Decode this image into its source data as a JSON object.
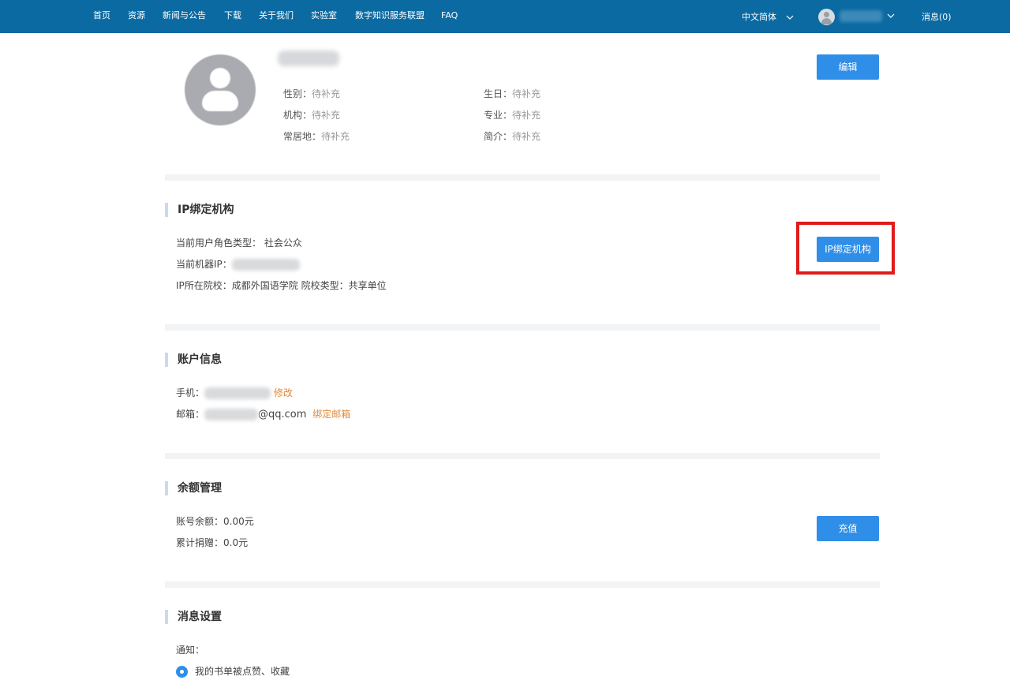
{
  "nav": {
    "items": [
      "首页",
      "资源",
      "新闻与公告",
      "下载",
      "关于我们",
      "实验室",
      "数字知识服务联盟",
      "FAQ"
    ],
    "language": "中文简体",
    "messages": "消息(0)"
  },
  "profile": {
    "edit_button": "编辑",
    "gender_label": "性别：",
    "gender_value": "待补充",
    "birthday_label": "生日：",
    "birthday_value": "待补充",
    "org_label": "机构：",
    "org_value": "待补充",
    "major_label": "专业：",
    "major_value": "待补充",
    "residence_label": "常居地：",
    "residence_value": "待补充",
    "intro_label": "简介：",
    "intro_value": "待补充"
  },
  "ip_binding": {
    "title": "IP绑定机构",
    "role_line": "当前用户角色类型：  社会公众",
    "ip_label": "当前机器IP：",
    "school_line": "IP所在院校：成都外国语学院   院校类型：共享单位",
    "button": "IP绑定机构"
  },
  "account": {
    "title": "账户信息",
    "phone_label": "手机：",
    "phone_action": "修改",
    "email_label": "邮箱：",
    "email_suffix": "@qq.com",
    "email_action": "绑定邮箱"
  },
  "balance": {
    "title": "余额管理",
    "balance_line": "账号余额：0.00元",
    "donation_line": "累计捐赠：0.0元",
    "recharge_button": "充值"
  },
  "notifications": {
    "title": "消息设置",
    "notify_label": "通知：",
    "option1": "我的书单被点赞、收藏"
  },
  "colors": {
    "nav_bg": "#0b6aa2",
    "primary": "#2f8ee8",
    "link_orange": "#e08a3a",
    "highlight_red": "#e01b1b"
  }
}
